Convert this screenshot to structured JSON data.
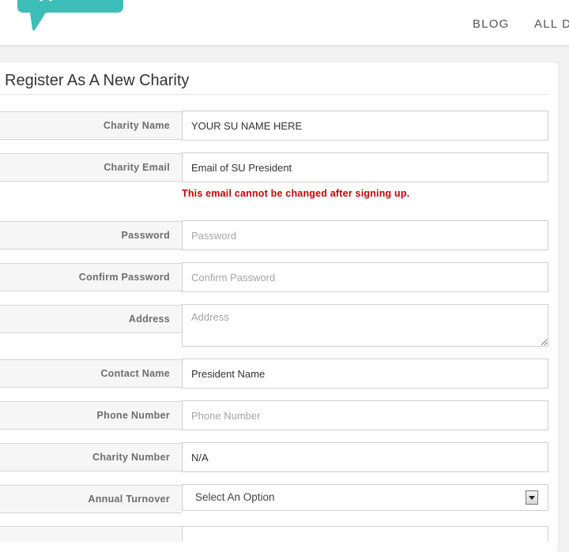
{
  "nav": {
    "blog": "BLOG",
    "all": "ALL D"
  },
  "colors": {
    "brand": "#3dbdb8",
    "warning": "#cc0000"
  },
  "form": {
    "title": "Register As A New Charity",
    "fields": {
      "charity_name": {
        "label": "Charity Name",
        "value": "YOUR SU NAME HERE"
      },
      "charity_email": {
        "label": "Charity Email",
        "value": "Email of SU President"
      },
      "email_warning": "This email cannot be changed after signing up.",
      "password": {
        "label": "Password",
        "placeholder": "Password"
      },
      "confirm_password": {
        "label": "Confirm Password",
        "placeholder": "Confirm Password"
      },
      "address": {
        "label": "Address",
        "placeholder": "Address"
      },
      "contact_name": {
        "label": "Contact Name",
        "value": "President Name"
      },
      "phone_number": {
        "label": "Phone Number",
        "placeholder": "Phone Number"
      },
      "charity_number": {
        "label": "Charity Number",
        "value": "N/A"
      },
      "annual_turnover": {
        "label": "Annual Turnover",
        "selected": "Select An Option"
      }
    }
  }
}
